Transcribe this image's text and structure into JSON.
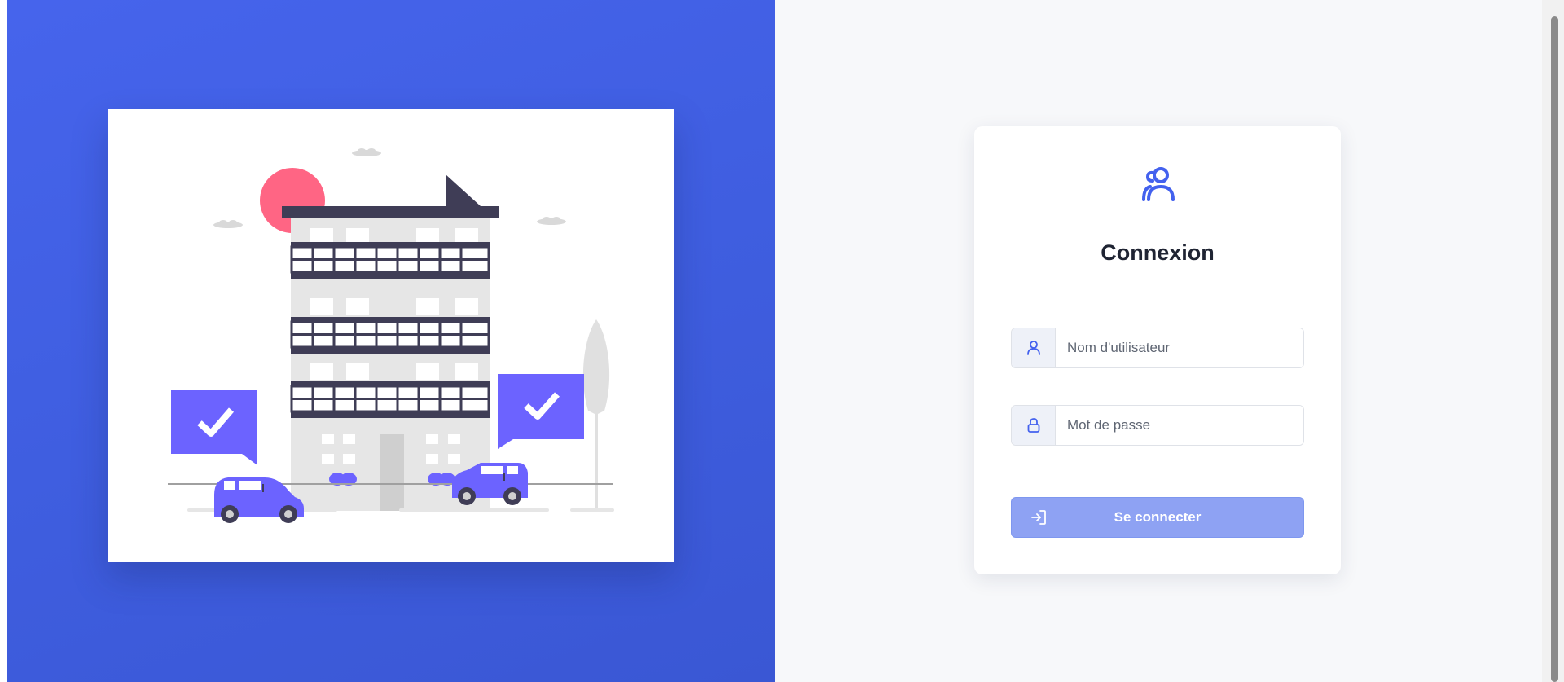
{
  "login": {
    "title": "Connexion",
    "username_placeholder": "Nom d'utilisateur",
    "username_value": "",
    "password_placeholder": "Mot de passe",
    "password_value": "",
    "submit_label": "Se connecter"
  },
  "icons": {
    "header": "users-icon",
    "username": "user-icon",
    "password": "lock-icon",
    "submit": "sign-in-icon"
  },
  "colors": {
    "hero_background": "#4260e3",
    "accent": "#4361ee",
    "button_disabled": "#8ea2f3",
    "illustration_purple": "#6c63ff",
    "illustration_sun": "#ff6584",
    "illustration_dark": "#3f3d56"
  }
}
